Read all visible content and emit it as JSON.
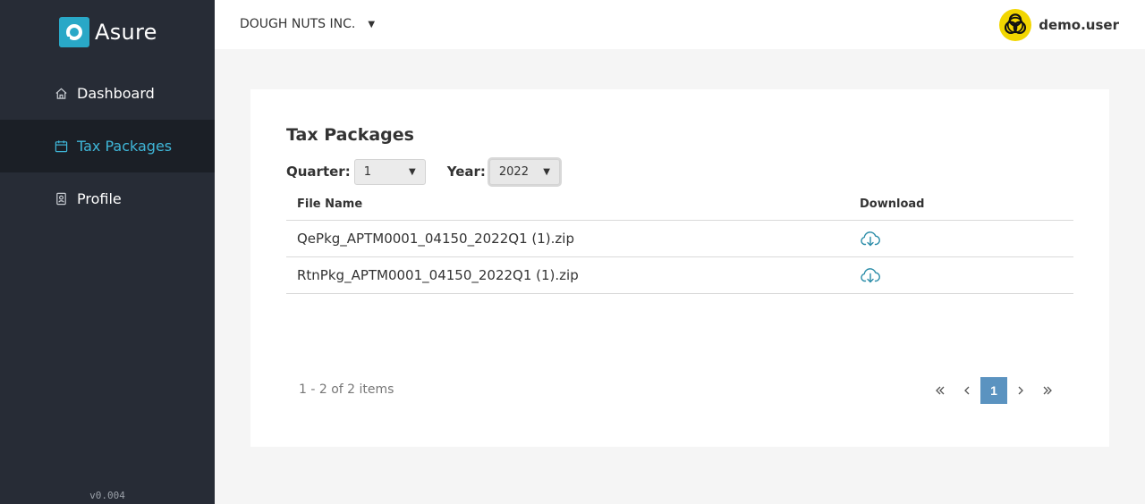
{
  "app": {
    "logo_text": "Asure",
    "version": "v0.004"
  },
  "sidebar": {
    "items": [
      {
        "label": "Dashboard",
        "icon": "home-icon",
        "active": false
      },
      {
        "label": "Tax Packages",
        "icon": "calendar-icon",
        "active": true
      },
      {
        "label": "Profile",
        "icon": "id-badge-icon",
        "active": false
      }
    ]
  },
  "header": {
    "company": "DOUGH NUTS INC.",
    "username": "demo.user",
    "avatar_icon": "biohazard-icon"
  },
  "main": {
    "title": "Tax Packages",
    "filters": {
      "quarter_label": "Quarter:",
      "quarter_value": "1",
      "year_label": "Year:",
      "year_value": "2022"
    },
    "table": {
      "columns": [
        "File Name",
        "Download"
      ],
      "rows": [
        {
          "file_name": "QePkg_APTM0001_04150_2022Q1 (1).zip",
          "download_icon": "cloud-download-icon"
        },
        {
          "file_name": "RtnPkg_APTM0001_04150_2022Q1 (1).zip",
          "download_icon": "cloud-download-icon"
        }
      ]
    },
    "pager": {
      "info": "1 - 2 of 2 items",
      "current_page": "1"
    }
  },
  "colors": {
    "sidebar_bg": "#272c36",
    "active_bg": "#1b1f26",
    "accent": "#3fb6d8",
    "page_button": "#5b93c0",
    "download_icon": "#2a8ca8"
  }
}
